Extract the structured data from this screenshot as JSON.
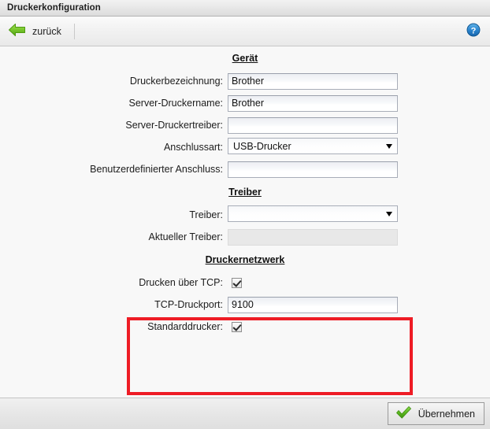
{
  "window": {
    "title": "Druckerkonfiguration"
  },
  "toolbar": {
    "back_label": "zurück",
    "back_icon": "arrow-left-icon",
    "help_icon": "help-question-icon"
  },
  "form": {
    "sections": [
      {
        "heading": "Gerät",
        "fields": [
          {
            "label": "Druckerbezeichnung:",
            "type": "text",
            "value": "Brother",
            "disabled": false
          },
          {
            "label": "Server-Druckername:",
            "type": "text",
            "value": "Brother",
            "disabled": false
          },
          {
            "label": "Server-Druckertreiber:",
            "type": "text",
            "value": "",
            "disabled": false
          },
          {
            "label": "Anschlussart:",
            "type": "select",
            "value": "USB-Drucker",
            "disabled": false
          },
          {
            "label": "Benutzerdefinierter Anschluss:",
            "type": "text",
            "value": "",
            "disabled": false
          }
        ]
      },
      {
        "heading": "Treiber",
        "fields": [
          {
            "label": "Treiber:",
            "type": "select",
            "value": "",
            "disabled": false
          },
          {
            "label": "Aktueller Treiber:",
            "type": "text",
            "value": "",
            "disabled": true
          }
        ]
      },
      {
        "heading": "Druckernetzwerk",
        "fields": [
          {
            "label": "Drucken über TCP:",
            "type": "checkbox",
            "checked": true,
            "disabled": false
          },
          {
            "label": "TCP-Druckport:",
            "type": "text",
            "value": "9100",
            "disabled": false
          },
          {
            "label": "Standarddrucker:",
            "type": "checkbox",
            "checked": true,
            "disabled": false
          }
        ]
      }
    ]
  },
  "highlight": {
    "color": "#ee1c25"
  },
  "footer": {
    "apply_label": "Übernehmen",
    "apply_icon": "green-check-icon"
  }
}
